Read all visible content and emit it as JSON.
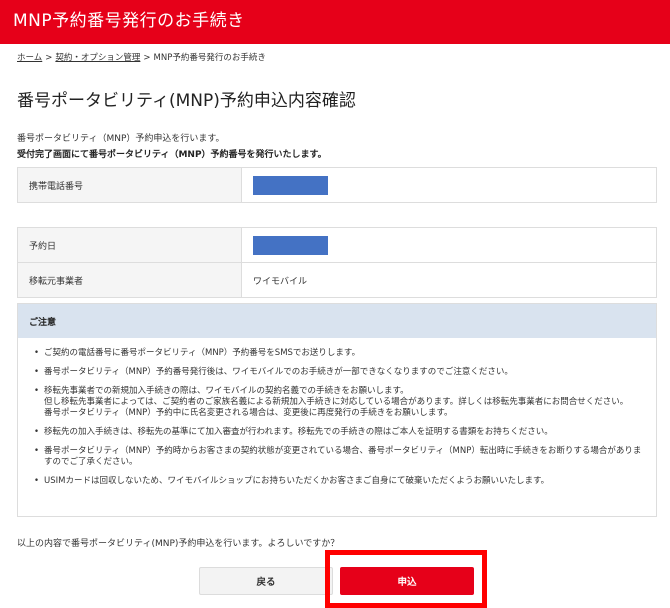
{
  "header": {
    "title": "MNP予約番号発行のお手続き"
  },
  "breadcrumb": {
    "home": "ホーム",
    "contract": "契約・オプション管理",
    "current": "MNP予約番号発行のお手続き",
    "separator": ">"
  },
  "page_title": "番号ポータビリティ(MNP)予約申込内容確認",
  "intro": {
    "line1": "番号ポータビリティ（MNP）予約申込を行います。",
    "line2": "受付完了画面にて番号ポータビリティ（MNP）予約番号を発行いたします。"
  },
  "table1": {
    "phone_label": "携帯電話番号"
  },
  "table2": {
    "date_label": "予約日",
    "carrier_label": "移転元事業者",
    "carrier_value": "ワイモバイル"
  },
  "notice": {
    "heading": "ご注意",
    "items": [
      {
        "lines": [
          "ご契約の電話番号に番号ポータビリティ（MNP）予約番号をSMSでお送りします。"
        ]
      },
      {
        "lines": [
          "番号ポータビリティ（MNP）予約番号発行後は、ワイモバイルでのお手続きが一部できなくなりますのでご注意ください。"
        ]
      },
      {
        "lines": [
          "移転先事業者での新規加入手続きの際は、ワイモバイルの契約名義での手続きをお願いします。",
          "但し移転先事業者によっては、ご契約者のご家族名義による新規加入手続きに対応している場合があります。詳しくは移転先事業者にお問合せください。",
          "番号ポータビリティ（MNP）予約中に氏名変更される場合は、変更後に再度発行の手続きをお願いします。"
        ]
      },
      {
        "lines": [
          "移転先の加入手続きは、移転先の基準にて加入審査が行われます。移転先での手続きの際はご本人を証明する書類をお持ちください。"
        ]
      },
      {
        "lines": [
          "番号ポータビリティ（MNP）予約時からお客さまの契約状態が変更されている場合、番号ポータビリティ（MNP）転出時に手続きをお断りする場合がありますのでご了承ください。"
        ]
      },
      {
        "lines": [
          "USIMカードは回収しないため、ワイモバイルショップにお持ちいただくかお客さまご自身にて破棄いただくようお願いいたします。"
        ]
      }
    ]
  },
  "confirm_question": "以上の内容で番号ポータビリティ(MNP)予約申込を行います。よろしいですか？",
  "buttons": {
    "back": "戻る",
    "apply": "申込"
  },
  "colors": {
    "brand_red": "#e60019",
    "highlight_red": "#ff0000",
    "masked_blue": "#4472c4",
    "notice_header_bg": "#d9e3ef"
  }
}
